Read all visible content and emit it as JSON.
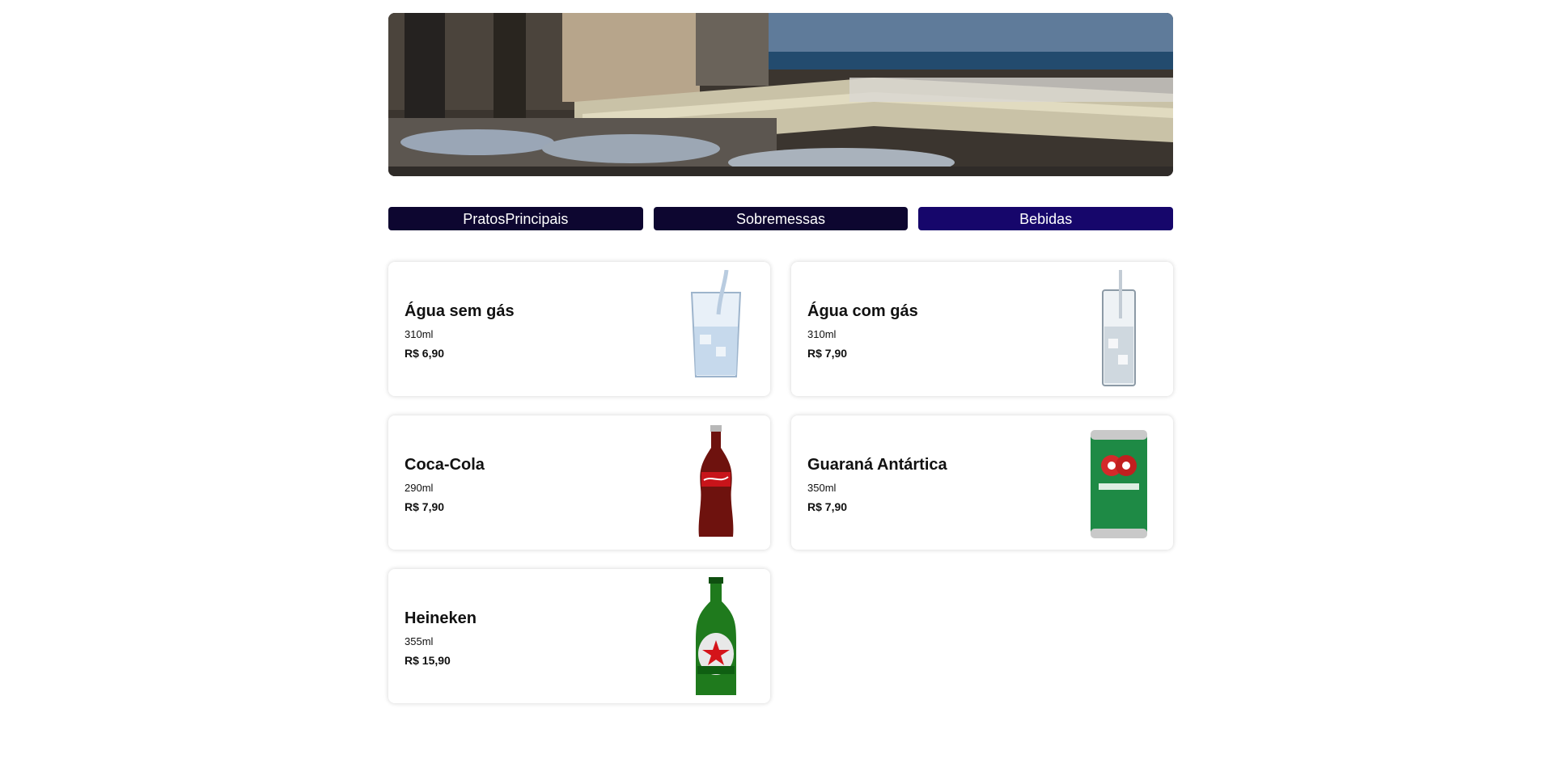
{
  "hero": {
    "alt": "restaurant terrace by the sea"
  },
  "tabs": [
    {
      "label": "PratosPrincipais",
      "active": false
    },
    {
      "label": "Sobremessas",
      "active": false
    },
    {
      "label": "Bebidas",
      "active": true
    }
  ],
  "products": [
    {
      "name": "Água sem gás",
      "volume": "310ml",
      "price": "R$ 6,90",
      "image": "water-glass-icon"
    },
    {
      "name": "Água com gás",
      "volume": "310ml",
      "price": "R$ 7,90",
      "image": "sparkling-glass-icon"
    },
    {
      "name": "Coca-Cola",
      "volume": "290ml",
      "price": "R$ 7,90",
      "image": "coke-bottle-icon"
    },
    {
      "name": "Guaraná Antártica",
      "volume": "350ml",
      "price": "R$ 7,90",
      "image": "guarana-can-icon"
    },
    {
      "name": "Heineken",
      "volume": "355ml",
      "price": "R$ 15,90",
      "image": "heineken-bottle-icon"
    }
  ],
  "colors": {
    "tab": "#0d0630",
    "tab_active": "#16066b"
  }
}
